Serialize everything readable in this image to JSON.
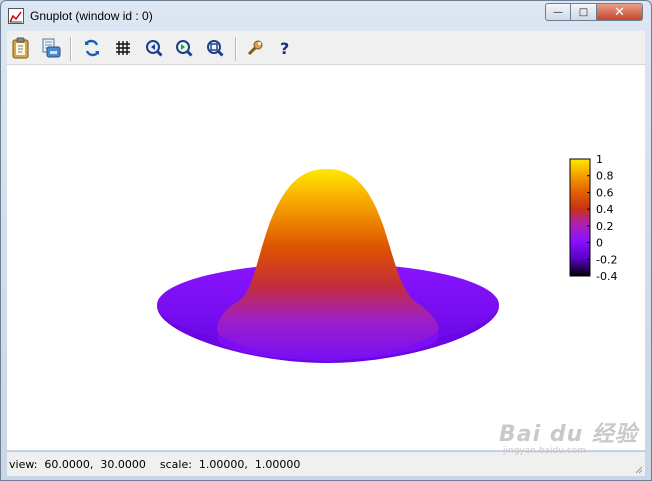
{
  "window": {
    "title": "Gnuplot (window id : 0)",
    "controls": {
      "minimize": "—",
      "maximize": "□",
      "close": "✕"
    }
  },
  "toolbar": {
    "items": [
      {
        "icon": "clipboard-icon"
      },
      {
        "icon": "print-icon"
      },
      {
        "icon": "replot-icon"
      },
      {
        "icon": "grid-icon"
      },
      {
        "icon": "zoom-previous-icon"
      },
      {
        "icon": "zoom-next-icon"
      },
      {
        "icon": "unzoom-icon"
      },
      {
        "icon": "options-wrench-icon"
      },
      {
        "icon": "help-icon"
      }
    ]
  },
  "chart_data": {
    "type": "surface",
    "function": "z = sin(r)/r style damped sombrero",
    "zrange": [
      -0.4,
      1
    ],
    "colorbox": {
      "ticks": [
        "1",
        "0.8",
        "0.6",
        "0.4",
        "0.2",
        "0",
        "-0.2",
        "-0.4"
      ],
      "values": [
        1,
        0.8,
        0.6,
        0.4,
        0.2,
        0,
        -0.2,
        -0.4
      ],
      "palette": [
        "#000000",
        "#7a00ff",
        "#cc3300",
        "#e66a00",
        "#ffee00"
      ]
    }
  },
  "status": {
    "text": "view:  60.0000,  30.0000    scale:  1.00000,  1.00000"
  },
  "watermark": {
    "main": "Bai du 经验",
    "sub": "jingyan.baidu.com"
  }
}
